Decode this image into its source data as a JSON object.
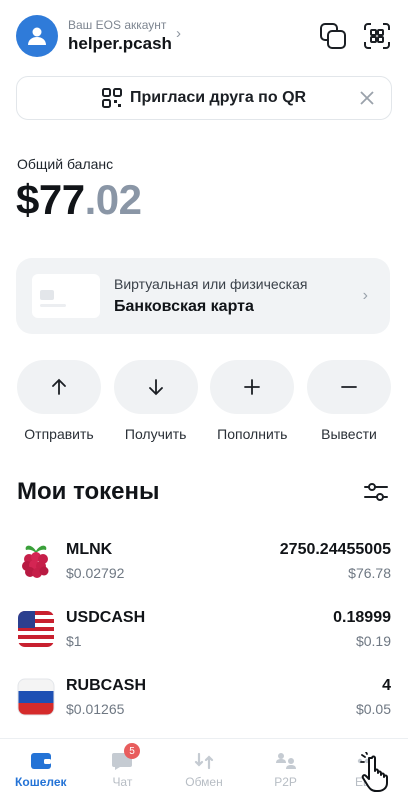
{
  "header": {
    "caption": "Ваш EOS аккаунт",
    "account_name": "helper.pcash",
    "chevron": "›"
  },
  "invite": {
    "label": "Пригласи друга по QR"
  },
  "balance": {
    "label": "Общий баланс",
    "whole": "$77",
    "cents": ".02"
  },
  "card_promo": {
    "subtitle": "Виртуальная или физическая",
    "title": "Банковская карта"
  },
  "actions": [
    {
      "label": "Отправить",
      "icon": "arrow-up-icon"
    },
    {
      "label": "Получить",
      "icon": "arrow-down-icon"
    },
    {
      "label": "Пополнить",
      "icon": "plus-icon"
    },
    {
      "label": "Вывести",
      "icon": "minus-icon"
    }
  ],
  "tokens": {
    "title": "Мои токены",
    "items": [
      {
        "name": "MLNK",
        "price": "$0.02792",
        "amount": "2750.24455005",
        "usd": "$76.78",
        "icon": "raspberry-icon"
      },
      {
        "name": "USDCASH",
        "price": "$1",
        "amount": "0.18999",
        "usd": "$0.19",
        "icon": "us-flag-icon"
      },
      {
        "name": "RUBCASH",
        "price": "$0.01265",
        "amount": "4",
        "usd": "$0.05",
        "icon": "ru-flag-icon"
      }
    ]
  },
  "nav": {
    "items": [
      {
        "label": "Кошелек",
        "active": true
      },
      {
        "label": "Чат",
        "badge": "5"
      },
      {
        "label": "Обмен"
      },
      {
        "label": "P2P"
      },
      {
        "label": "Еще"
      }
    ]
  },
  "colors": {
    "accent": "#2473d6",
    "avatar": "#2f7bd9",
    "badge": "#e85d5d"
  }
}
